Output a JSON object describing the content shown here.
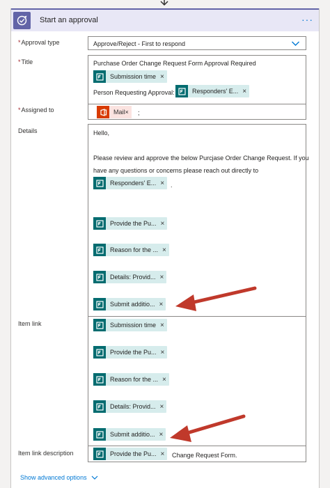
{
  "card": {
    "title": "Start an approval",
    "more": "···"
  },
  "fields": {
    "approval_type": {
      "label": "Approval type",
      "value": "Approve/Reject - First to respond"
    },
    "title": {
      "label": "Title",
      "line1": "Purchase Order Change Request Form Approval Required",
      "token1": "Submission time",
      "prefix2": "Person Requesting Approval:",
      "token2": "Responders' E..."
    },
    "assigned_to": {
      "label": "Assigned to",
      "token": "Mail",
      "suffix": ";"
    },
    "details": {
      "label": "Details",
      "greeting": "Hello,",
      "para1": "Please review and approve the below Purcjase Order Change Request. If you",
      "para2": "have any questions or concerns please reach out directly to",
      "token1": "Responders' E...",
      "token1_suffix": ".",
      "token2": "Provide the Pu...",
      "token3": "Reason for the ...",
      "token4": "Details: Provid...",
      "token5": "Submit additio..."
    },
    "item_link": {
      "label": "Item link",
      "token1": "Submission time",
      "token2": "Provide the Pu...",
      "token3": "Reason for the ...",
      "token4": "Details: Provid...",
      "token5": "Submit additio..."
    },
    "item_link_description": {
      "label": "Item link description",
      "token": "Provide the Pu...",
      "suffix": "Change Request Form."
    }
  },
  "advanced_options": "Show advanced options",
  "colors": {
    "accent": "#6264a7",
    "link": "#0078d4",
    "token_bg": "#d6ecec",
    "token_icon": "#036c70",
    "arrow": "#c0392b",
    "required": "#a4262c"
  },
  "close_glyph": "×"
}
